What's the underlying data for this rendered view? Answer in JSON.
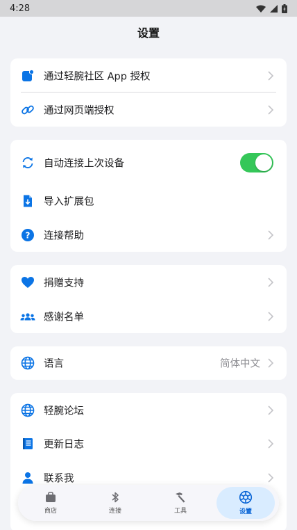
{
  "status_bar": {
    "time": "4:28"
  },
  "header": {
    "title": "设置"
  },
  "groups": {
    "auth": {
      "items": [
        {
          "label": "通过轻腕社区 App 授权",
          "icon": "app-badge-icon"
        },
        {
          "label": "通过网页端授权",
          "icon": "link-icon"
        }
      ]
    },
    "device": {
      "items": [
        {
          "label": "自动连接上次设备",
          "icon": "sync-icon",
          "toggle_on": true
        },
        {
          "label": "导入扩展包",
          "icon": "file-import-icon"
        },
        {
          "label": "连接帮助",
          "icon": "help-icon"
        }
      ]
    },
    "support": {
      "items": [
        {
          "label": "捐赠支持",
          "icon": "heart-icon"
        },
        {
          "label": "感谢名单",
          "icon": "people-icon"
        }
      ]
    },
    "language": {
      "items": [
        {
          "label": "语言",
          "icon": "globe-icon",
          "value": "简体中文"
        }
      ]
    },
    "about": {
      "items": [
        {
          "label": "轻腕论坛",
          "icon": "globe-icon"
        },
        {
          "label": "更新日志",
          "icon": "book-icon"
        },
        {
          "label": "联系我",
          "icon": "person-icon"
        }
      ]
    }
  },
  "tabbar": {
    "tabs": [
      {
        "label": "商店",
        "icon": "bag-icon"
      },
      {
        "label": "连接",
        "icon": "bluetooth-icon"
      },
      {
        "label": "工具",
        "icon": "hammer-icon"
      },
      {
        "label": "设置",
        "icon": "gear-icon",
        "active": true
      }
    ]
  },
  "colors": {
    "accent": "#0b74e5",
    "toggle_on": "#35c759",
    "background": "#f2f3f7",
    "card": "#ffffff",
    "active_tab_bg": "#d9ecff"
  }
}
